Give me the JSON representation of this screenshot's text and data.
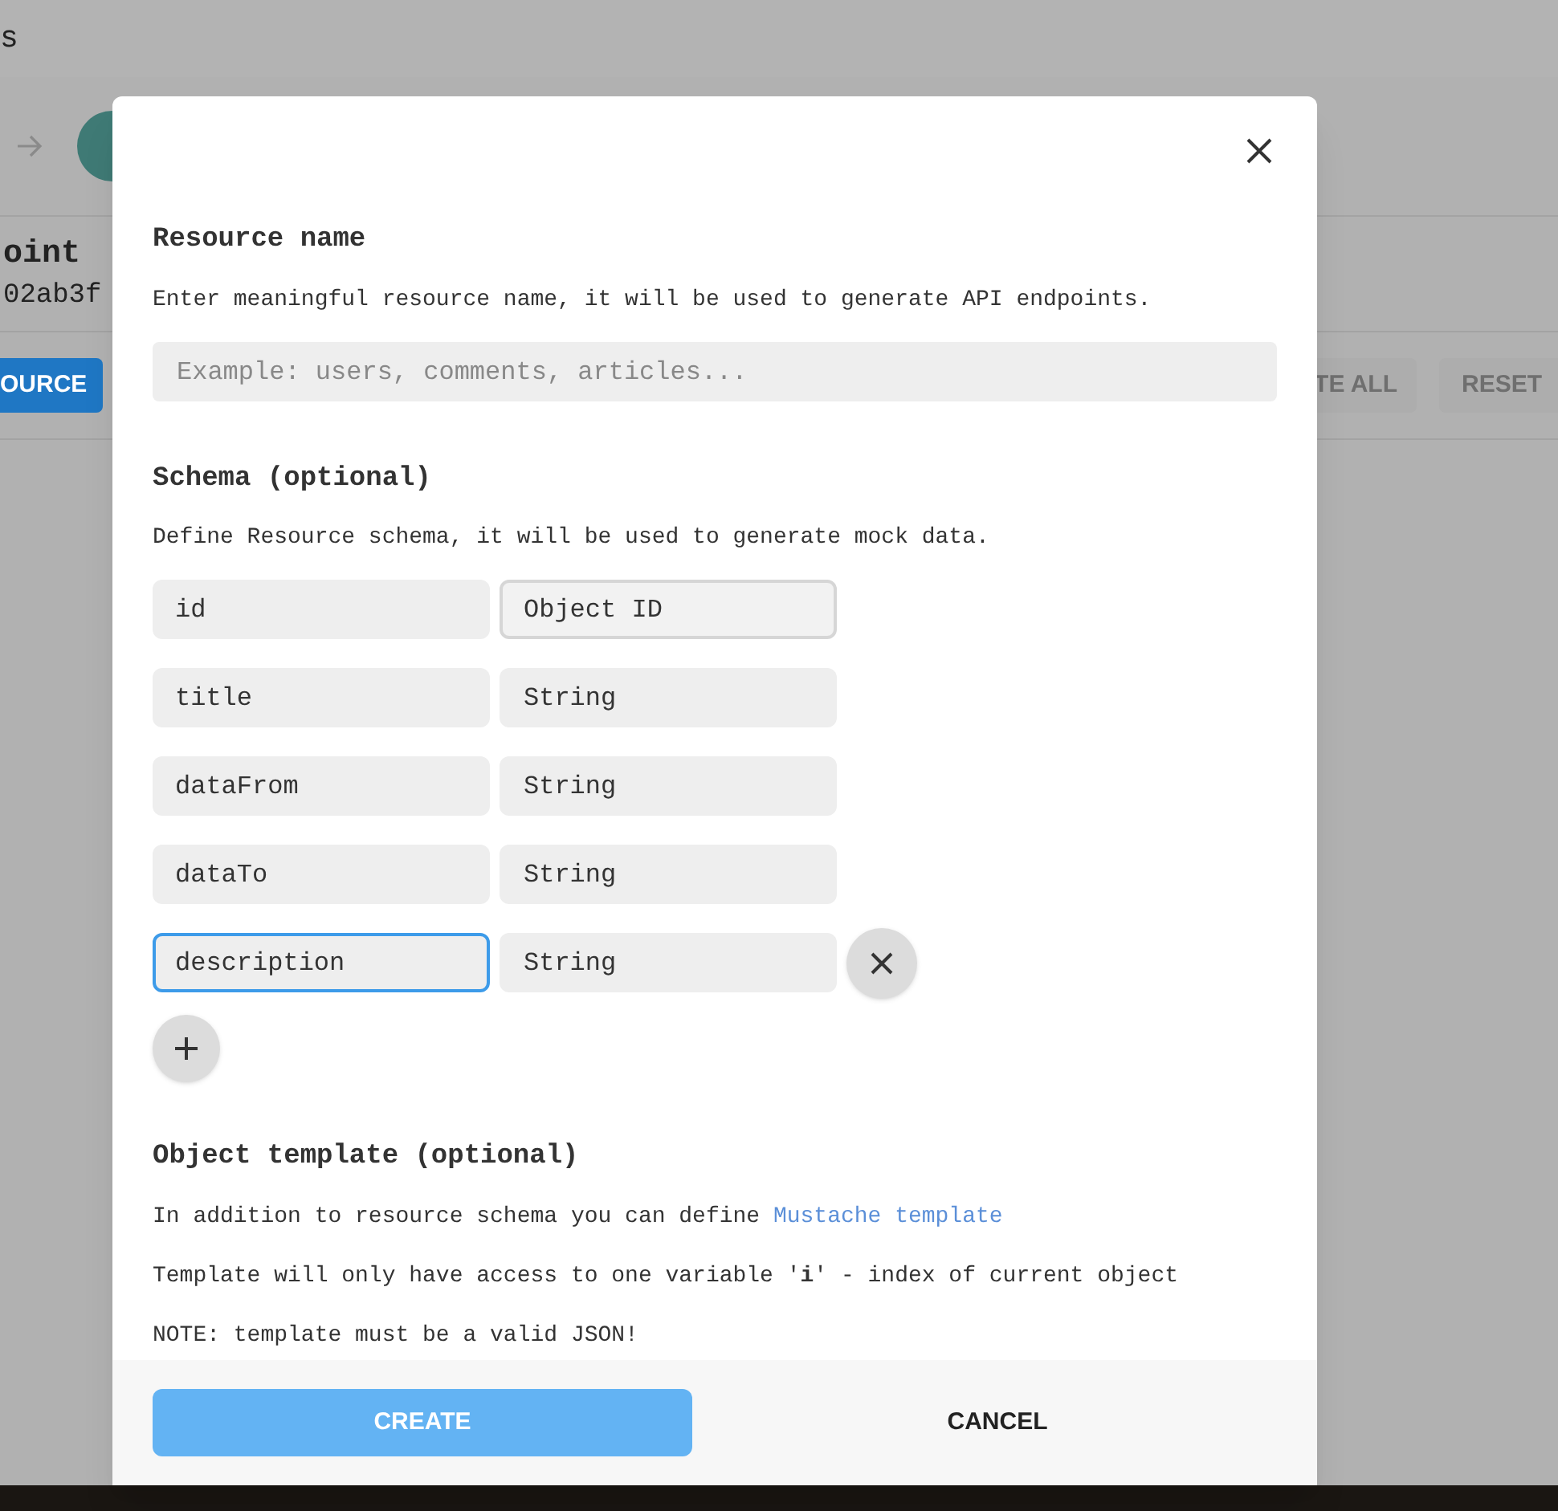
{
  "background": {
    "header_text": "s",
    "title": "oint",
    "id_text": "02ab3f",
    "buttons": [
      {
        "label": "OURCE",
        "kind": "primary"
      },
      {
        "label": "TE ALL",
        "kind": "plain"
      },
      {
        "label": "RESET",
        "kind": "plain"
      }
    ]
  },
  "dialog": {
    "resource": {
      "heading": "Resource name",
      "description": "Enter meaningful resource name, it will be used to generate API endpoints.",
      "placeholder": "Example: users, comments, articles..."
    },
    "schema": {
      "heading": "Schema (optional)",
      "description": "Define Resource schema, it will be used to generate mock data.",
      "rows": [
        {
          "name": "id",
          "type": "Object ID",
          "name_focused": false,
          "type_hovered": true,
          "removable": false
        },
        {
          "name": "title",
          "type": "String",
          "name_focused": false,
          "type_hovered": false,
          "removable": false
        },
        {
          "name": "dataFrom",
          "type": "String",
          "name_focused": false,
          "type_hovered": false,
          "removable": false
        },
        {
          "name": "dataTo",
          "type": "String",
          "name_focused": false,
          "type_hovered": false,
          "removable": false
        },
        {
          "name": "description",
          "type": "String",
          "name_focused": true,
          "type_hovered": false,
          "removable": true
        }
      ]
    },
    "template": {
      "heading": "Object template (optional)",
      "intro": "In addition to resource schema you can define",
      "link": "Mustache template",
      "notes": [
        "Template will only have access to one variable '**i**' - index of current object",
        "NOTE: template must be a valid JSON!"
      ]
    },
    "buttons": {
      "create": "CREATE",
      "cancel": "CANCEL"
    }
  }
}
